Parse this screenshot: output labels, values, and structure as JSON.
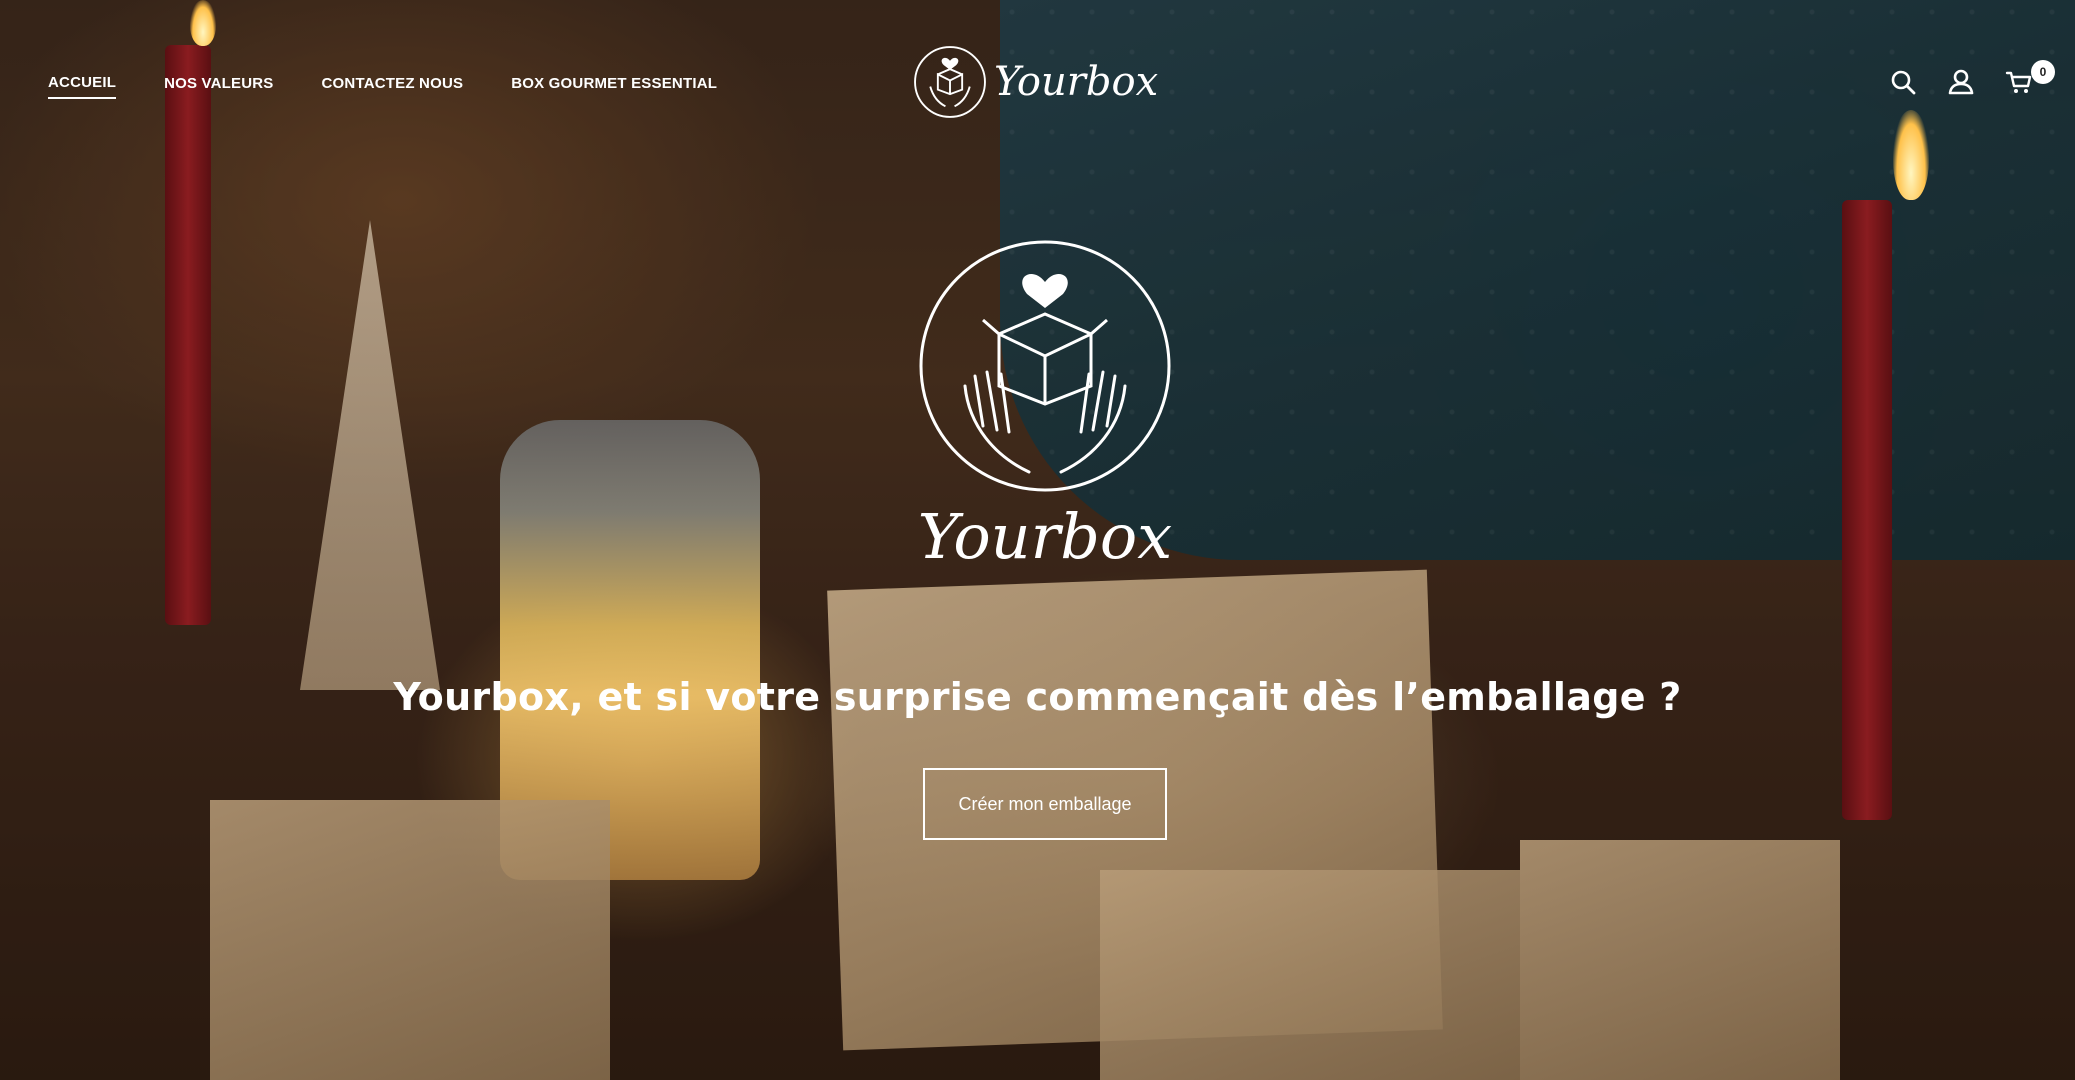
{
  "nav": {
    "items": [
      {
        "label": "ACCUEIL",
        "active": true
      },
      {
        "label": "NOS VALEURS",
        "active": false
      },
      {
        "label": "CONTACTEZ NOUS",
        "active": false
      },
      {
        "label": "BOX GOURMET ESSENTIAL",
        "active": false
      }
    ]
  },
  "brand": {
    "name": "Yourbox"
  },
  "header_icons": {
    "search": "search-icon",
    "account": "user-icon",
    "cart": "cart-icon",
    "cart_count": "0"
  },
  "hero": {
    "logo_text": "Yourbox",
    "headline": "Yourbox, et si votre surprise commençait dès l’emballage ?",
    "cta_label": "Créer mon emballage"
  },
  "colors": {
    "text": "#ffffff",
    "overlay": "#000000"
  }
}
